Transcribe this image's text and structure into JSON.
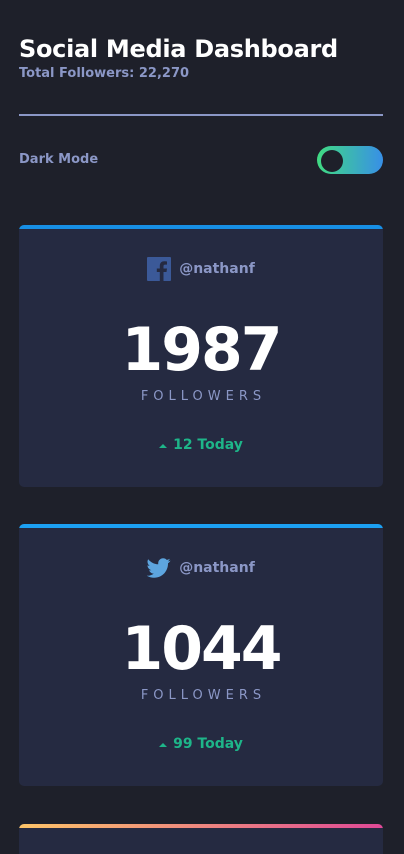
{
  "header": {
    "title": "Social Media Dashboard",
    "total_followers": "Total Followers: 22,270"
  },
  "dark_mode": {
    "label": "Dark Mode",
    "enabled": true
  },
  "colors": {
    "background": "#1e202a",
    "card": "#252a41",
    "muted_text": "#8b97c6",
    "up": "#1eb589",
    "facebook": "#178fe5",
    "twitter": "#1ca0f2",
    "instagram_gradient": [
      "#fdc468",
      "#df4996"
    ],
    "toggle_gradient": [
      "#40db82",
      "#388fe7"
    ]
  },
  "cards": [
    {
      "network": "facebook",
      "icon": "facebook-icon",
      "handle": "@nathanf",
      "count": "1987",
      "label": "FOLLOWERS",
      "today": "12 Today"
    },
    {
      "network": "twitter",
      "icon": "twitter-icon",
      "handle": "@nathanf",
      "count": "1044",
      "label": "FOLLOWERS",
      "today": "99 Today"
    },
    {
      "network": "instagram",
      "icon": "instagram-icon"
    }
  ]
}
